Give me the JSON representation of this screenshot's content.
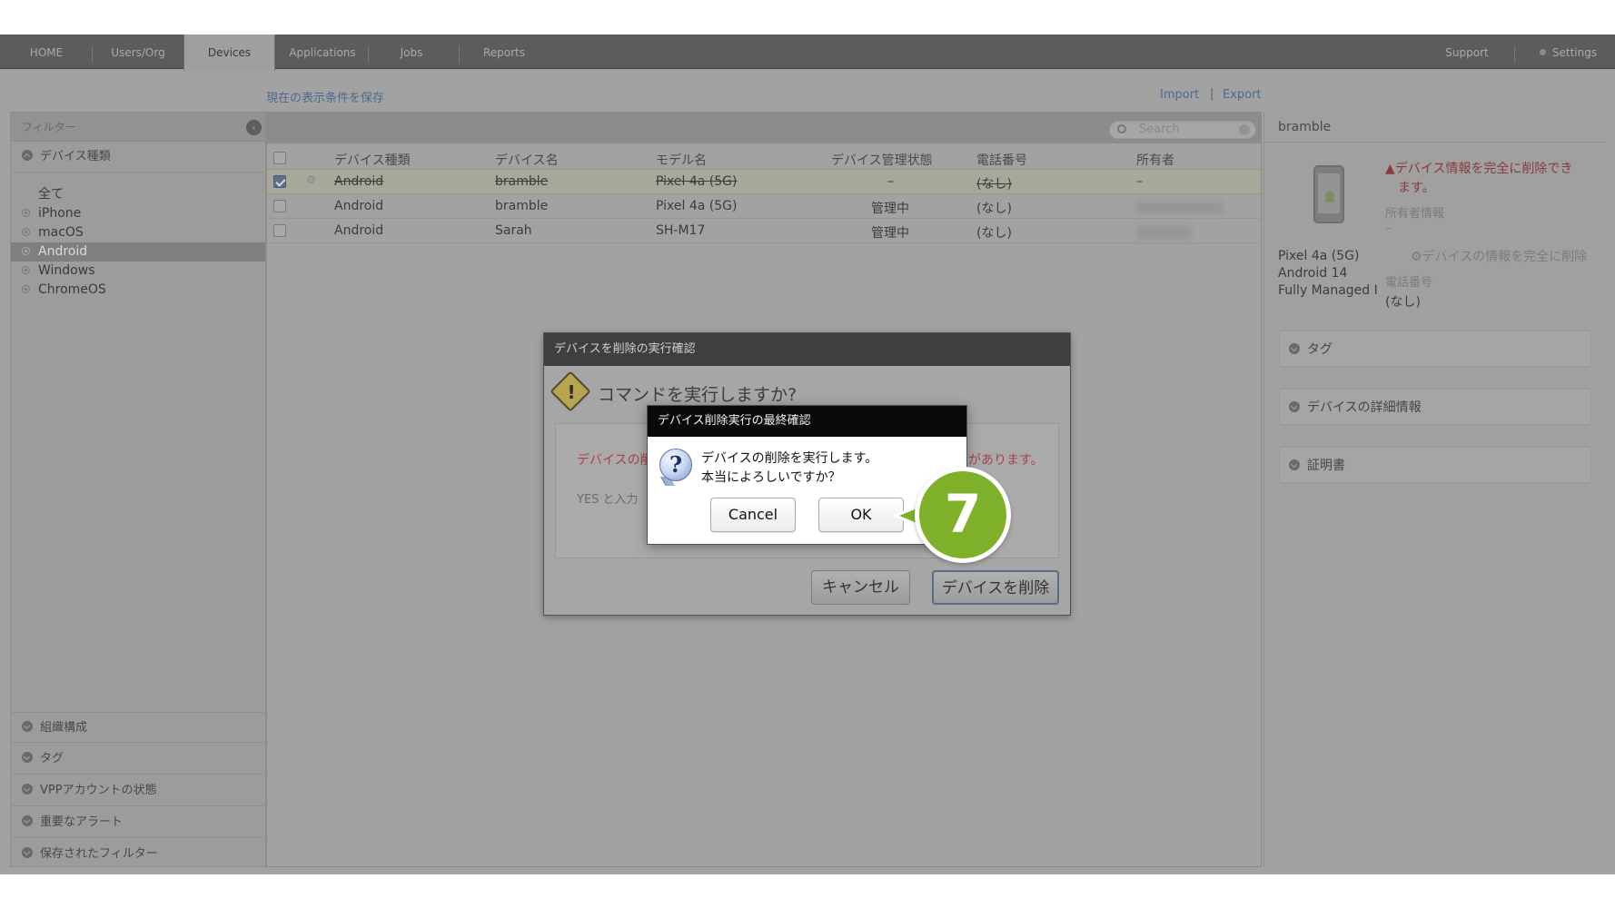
{
  "nav": {
    "tabs": [
      {
        "label": "HOME"
      },
      {
        "label": "Users/Org"
      },
      {
        "label": "Devices"
      },
      {
        "label": "Applications"
      },
      {
        "label": "Jobs"
      },
      {
        "label": "Reports"
      }
    ],
    "support": "Support",
    "settings": "Settings"
  },
  "toolbar": {
    "save_filter": "現在の表示条件を保存",
    "import": "Import",
    "sep": "|",
    "export": "Export"
  },
  "filters": {
    "title": "フィルター",
    "device_type_header": "デバイス種類",
    "items": [
      "全て",
      "iPhone",
      "macOS",
      "Android",
      "Windows",
      "ChromeOS"
    ],
    "selected": "Android",
    "bottom_sections": [
      "組織構成",
      "タグ",
      "VPPアカウントの状態",
      "重要なアラート",
      "保存されたフィルター"
    ]
  },
  "table": {
    "search_placeholder": "Search",
    "columns": [
      "デバイス種類",
      "デバイス名",
      "モデル名",
      "デバイス管理状態",
      "電話番号",
      "所有者"
    ],
    "rows": [
      {
        "type": "Android",
        "name": "bramble",
        "model": "Pixel 4a (5G)",
        "status": "–",
        "phone": "(なし)",
        "owner": "–",
        "checked": true
      },
      {
        "type": "Android",
        "name": "bramble",
        "model": "Pixel 4a (5G)",
        "status": "管理中",
        "phone": "(なし)",
        "owner": "",
        "checked": false
      },
      {
        "type": "Android",
        "name": "Sarah",
        "model": "SH-M17",
        "status": "管理中",
        "phone": "(なし)",
        "owner": "",
        "checked": false
      }
    ]
  },
  "detail": {
    "title": "bramble",
    "model": "Pixel 4a (5G)",
    "os": "Android 14",
    "mode": "Fully Managed I",
    "warning_line1": "デバイス情報を完全に削除でき",
    "warning_line2": "ます。",
    "owner_label": "所有者情報",
    "owner_value": "–",
    "wipe_link": "デバイスの情報を完全に削除",
    "phone_label": "電話番号",
    "phone_value": "(なし)",
    "sections": [
      "タグ",
      "デバイスの詳細情報",
      "証明書"
    ]
  },
  "dialog1": {
    "title": "デバイスを削除の実行確認",
    "question": "コマンドを実行しますか?",
    "red_left": "デバイスの削",
    "red_right": "があります。",
    "yes_hint": "YES と入力",
    "cancel": "キャンセル",
    "confirm": "デバイスを削除"
  },
  "dialog2": {
    "title": "デバイス削除実行の最終確認",
    "line1": "デバイスの削除を実行します。",
    "line2": "本当によろしいですか？",
    "cancel": "Cancel",
    "ok": "OK"
  },
  "callout": {
    "number": "7"
  },
  "colors": {
    "callout": "#7fb02a",
    "dialog_title": "#0a0a0a",
    "overlay": "#a2a2a2"
  }
}
